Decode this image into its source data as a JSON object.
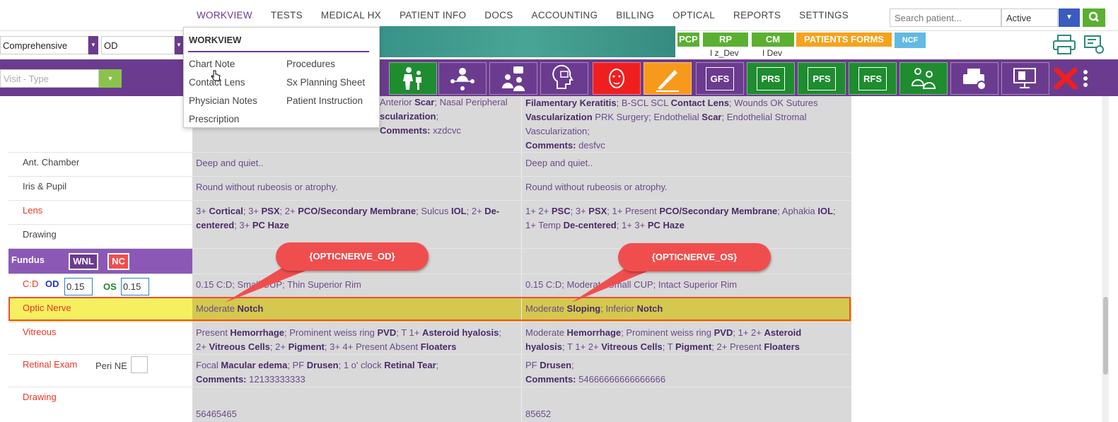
{
  "nav": {
    "items": [
      "WORKVIEW",
      "TESTS",
      "MEDICAL HX",
      "PATIENT INFO",
      "DOCS",
      "ACCOUNTING",
      "BILLING",
      "OPTICAL",
      "REPORTS",
      "SETTINGS"
    ],
    "search_placeholder": "Search patient...",
    "status": "Active"
  },
  "bar2": {
    "exam_type": "Comprehensive",
    "eye": "OD",
    "tags": [
      {
        "label": "PCP",
        "sub": ""
      },
      {
        "label": "RP",
        "sub": "I z_Dev"
      },
      {
        "label": "CM",
        "sub": "I Dev"
      },
      {
        "label": "PATIENTS FORMS",
        "sub": ""
      },
      {
        "label": "NCF",
        "sub": ""
      }
    ]
  },
  "toolbar": {
    "visit_type_placeholder": "Visit - Type",
    "text_buttons": [
      "GFS",
      "PRS",
      "PFS",
      "RFS"
    ]
  },
  "menu": {
    "title": "WORKVIEW",
    "left_items": [
      "Chart Note",
      "Contact Lens",
      "Physician Notes",
      "Prescription"
    ],
    "right_items": [
      "Procedures",
      "Sx Planning Sheet",
      "Patient Instruction"
    ]
  },
  "exam": {
    "cornea_od": {
      "prefix": "Anterior ",
      "b1": "Scar",
      "mid": "; Nasal Peripheral",
      "line2_b": "scularization",
      "line2_rest": ";",
      "comments_label": "Comments:",
      "comments": "xzdcvc"
    },
    "cornea_os": {
      "b1": "Filamentary Keratitis",
      "mid1": "; B-SCL SCL ",
      "b2": "Contact Lens",
      "mid2": "; Wounds OK Sutures",
      "b3": "Vascularization",
      "mid3": " PRK Surgery; Endothelial ",
      "b4": "Scar",
      "mid4": "; Endothelial Stromal",
      "line3": "Vascularization;",
      "comments_label": "Comments:",
      "comments": "desfvc"
    },
    "rows": [
      {
        "label": "Ant. Chamber",
        "od": "Deep and quiet..",
        "os": "Deep and quiet.."
      },
      {
        "label": "Iris & Pupil",
        "od": "Round without rubeosis or atrophy.",
        "os": "Round without rubeosis or atrophy."
      }
    ],
    "lens": {
      "label": "Lens"
    },
    "drawing_label": "Drawing",
    "fundus": {
      "label": "Fundus",
      "wnl": "WNL",
      "nc": "NC"
    },
    "cd": {
      "label": "C:D",
      "od_label": "OD",
      "os_label": "OS",
      "od_value": "0.15",
      "os_value": "0.15",
      "od_text": "0.15 C:D; Small CUP; Thin Superior Rim",
      "os_text": "0.15 C:D; Moderate Small CUP; Intact Superior Rim"
    },
    "optic_nerve": {
      "label": "Optic Nerve",
      "od_pre": "Moderate ",
      "od_b": "Notch",
      "os_pre": "Moderate ",
      "os_b1": "Sloping",
      "os_mid": "; Inferior ",
      "os_b2": "Notch"
    },
    "vitreous": {
      "label": "Vitreous"
    },
    "retinal": {
      "label": "Retinal Exam",
      "peri_ne": "Peri NE",
      "od_comments": "12133333333",
      "os_comments": "54666666666666666"
    },
    "drawing2": {
      "label": "Drawing",
      "od_value": "56465465",
      "os_value": "85652"
    }
  },
  "callouts": {
    "od": "{OPTICNERVE_OD}",
    "os": "{OPTICNERVE_OS}"
  },
  "colors": {
    "purple": "#6b3b8f",
    "green": "#5ab031",
    "red_callout": "#f04e4e",
    "highlight": "#f24e2e"
  }
}
